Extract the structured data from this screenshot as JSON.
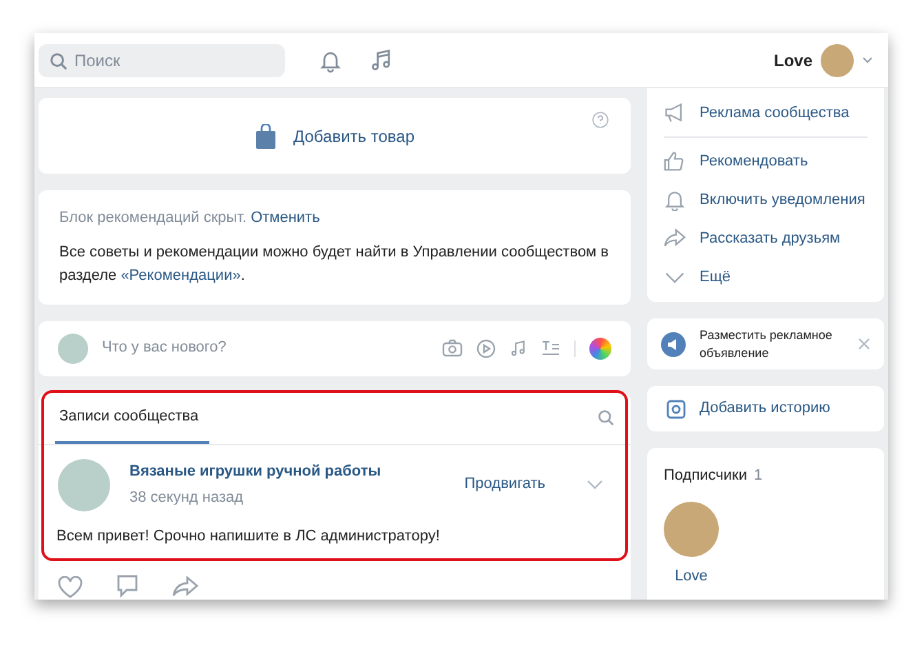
{
  "header": {
    "search": {
      "placeholder": "Поиск"
    },
    "user": {
      "name": "Love"
    }
  },
  "product_card": {
    "label": "Добавить товар"
  },
  "recommendations_notice": {
    "status": "Блок рекомендаций скрыт.",
    "action": "Отменить",
    "message_before": "Все советы и рекомендации можно будет найти в Управлении сообществом в разделе ",
    "message_link": "«Рекомендации»",
    "message_after": "."
  },
  "composer": {
    "placeholder": "Что у вас нового?"
  },
  "wall": {
    "highlighted": true,
    "tabs": [
      {
        "label": "Записи сообщества",
        "selected": true
      }
    ],
    "post": {
      "author": "Вязаные игрушки ручной работы",
      "time": "38 секунд назад",
      "promote": "Продвигать",
      "text": "Всем привет! Срочно напишите в ЛС администратору!"
    }
  },
  "menu": {
    "items": [
      {
        "label": "Реклама сообщества"
      },
      {
        "label": "Рекомендовать"
      },
      {
        "label": "Включить уведомления"
      },
      {
        "label": "Рассказать друзьям"
      },
      {
        "label": "Ещё"
      }
    ]
  },
  "ad_card": {
    "text": "Разместить рекламное объявление"
  },
  "story_card": {
    "label": "Добавить историю"
  },
  "subscribers": {
    "title": "Подписчики",
    "count": "1",
    "people": [
      {
        "name": "Love"
      }
    ]
  }
}
